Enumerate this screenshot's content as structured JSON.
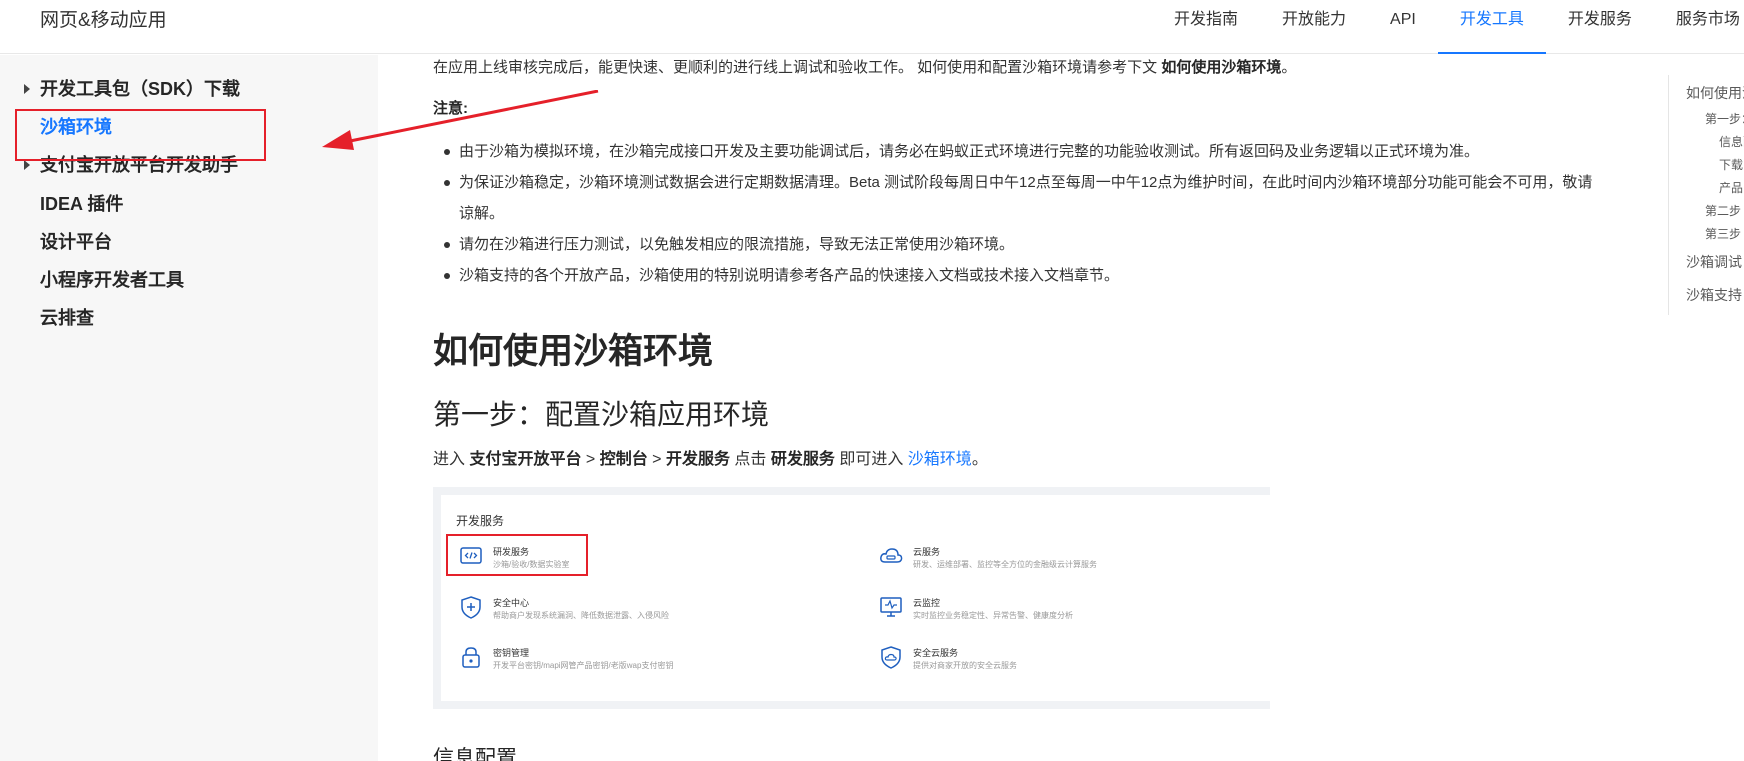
{
  "header": {
    "brand": "网页&移动应用",
    "nav": [
      "开发指南",
      "开放能力",
      "API",
      "开发工具",
      "开发服务",
      "服务市场"
    ],
    "active_nav": "开发工具"
  },
  "sidebar": {
    "items": [
      {
        "label": "开发工具包（SDK）下载",
        "expandable": true
      },
      {
        "label": "沙箱环境",
        "active": true
      },
      {
        "label": "支付宝开放平台开发助手",
        "expandable": true
      },
      {
        "label": "IDEA 插件"
      },
      {
        "label": "设计平台"
      },
      {
        "label": "小程序开发者工具"
      },
      {
        "label": "云排查"
      }
    ]
  },
  "content": {
    "intro_text": "在应用上线审核完成后，能更快速、更顺利的进行线上调试和验收工作。 如何使用和配置沙箱环境请参考下文 ",
    "intro_bold": "如何使用沙箱环境",
    "intro_end": "。",
    "note_label": "注意:",
    "bullets": [
      "由于沙箱为模拟环境，在沙箱完成接口开发及主要功能调试后，请务必在蚂蚁正式环境进行完整的功能验收测试。所有返回码及业务逻辑以正式环境为准。",
      "为保证沙箱稳定，沙箱环境测试数据会进行定期数据清理。Beta 测试阶段每周日中午12点至每周一中午12点为维护时间，在此时间内沙箱环境部分功能可能会不可用，敬请谅解。",
      "请勿在沙箱进行压力测试，以免触发相应的限流措施，导致无法正常使用沙箱环境。",
      "沙箱支持的各个开放产品，沙箱使用的特别说明请参考各产品的快速接入文档或技术接入文档章节。"
    ],
    "h1": "如何使用沙箱环境",
    "h2": "第一步：配置沙箱应用环境",
    "step": {
      "prefix": "进入 ",
      "a": "支付宝开放平台",
      "sep1": " > ",
      "b": "控制台",
      "sep2": " > ",
      "c": "开发服务",
      "mid": " 点击 ",
      "d": "研发服务",
      "mid2": " 即可进入 ",
      "link": "沙箱环境",
      "end": "。"
    },
    "next_heading": "信息配置"
  },
  "screenshot": {
    "title": "开发服务",
    "services": [
      {
        "name": "研发服务",
        "desc": "沙箱/验收/数据实验室",
        "icon": "code-icon"
      },
      {
        "name": "云服务",
        "desc": "研发、运维部署、监控等全方位的金融级云计算服务",
        "icon": "cloud-icon"
      },
      {
        "name": "安全中心",
        "desc": "帮助商户发现系统漏洞、降低数据泄露、入侵风险",
        "icon": "shield-plus-icon"
      },
      {
        "name": "云监控",
        "desc": "实时监控业务稳定性、异常告警、健康度分析",
        "icon": "monitor-icon"
      },
      {
        "name": "密钥管理",
        "desc": "开发平台密钥/mapi网管产品密钥/老版wap支付密钥",
        "icon": "lock-icon"
      },
      {
        "name": "安全云服务",
        "desc": "提供对商家开放的安全云服务",
        "icon": "shield-cloud-icon"
      }
    ]
  },
  "toc": {
    "items": [
      "如何使用沙箱环境",
      "第一步：配置沙箱应用环境",
      "信息配置",
      "下载",
      "产品",
      "第二步",
      "第三步",
      "沙箱调试",
      "沙箱支持"
    ]
  },
  "colors": {
    "accent": "#1677ff",
    "annotation_red": "#e5202a"
  }
}
